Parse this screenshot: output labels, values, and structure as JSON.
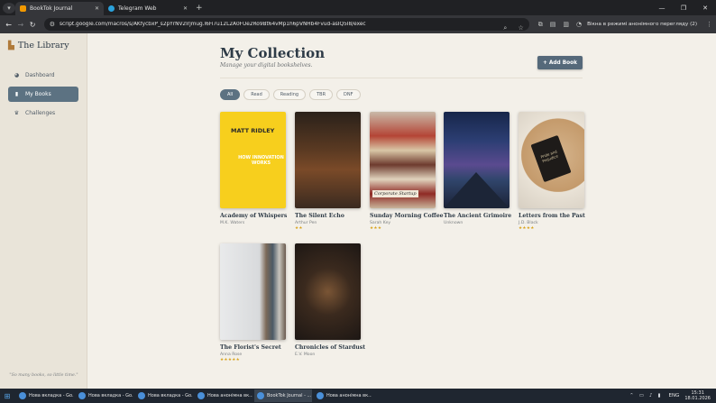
{
  "browser": {
    "tabs": [
      {
        "title": "BookTok Journal",
        "favicon_color": "#f29900",
        "active": true
      },
      {
        "title": "Telegram Web",
        "favicon_color": "#2aa1db",
        "active": false
      }
    ],
    "url": "script.google.com/macros/s/AKfycbxP_s2pYrNV2lrjmug.l6Fi7u12L2A0FUe2Ro9Bt64vMp1h6pVNHb4Fvud-asIQ5I8/exec",
    "incognito_label": "Вікна в режимі анонімного перегляду (2)"
  },
  "sidebar": {
    "brand": "The Library",
    "items": [
      {
        "label": "Dashboard",
        "icon": "dashboard-icon",
        "active": false
      },
      {
        "label": "My Books",
        "icon": "book-icon",
        "active": true
      },
      {
        "label": "Challenges",
        "icon": "trophy-icon",
        "active": false
      }
    ],
    "quote": "\"So many books, so little time.\""
  },
  "main": {
    "title": "My Collection",
    "subtitle": "Manage your digital bookshelves.",
    "add_button": "+ Add Book",
    "filters": [
      "All",
      "Read",
      "Reading",
      "TBR",
      "DNF"
    ],
    "active_filter": "All",
    "books": [
      {
        "title": "Academy of Whispers",
        "author": "M.K. Waters",
        "stars": "",
        "cover_text_1": "MATT RIDLEY",
        "cover_text_2": "HOW INNOVATION WORKS"
      },
      {
        "title": "The Silent Echo",
        "author": "Arthur Pen",
        "stars": "★★"
      },
      {
        "title": "Sunday Morning Coffee",
        "author": "Sarah Key",
        "stars": "★★★",
        "cover_text": "Corporate Startup"
      },
      {
        "title": "The Ancient Grimoire",
        "author": "Unknown",
        "stars": ""
      },
      {
        "title": "Letters from the Past",
        "author": "J.D. Black",
        "stars": "★★★★",
        "cover_text": "Pride and Prejudice"
      },
      {
        "title": "The Florist's Secret",
        "author": "Anna Rose",
        "stars": "★★★★★"
      },
      {
        "title": "Chronicles of Stardust",
        "author": "E.V. Moon",
        "stars": ""
      }
    ]
  },
  "taskbar": {
    "tasks": [
      "Нова вкладка - Go...",
      "Нова вкладка - Go...",
      "Нова вкладка - Go...",
      "Нова анонімна вк...",
      "BookTok Journal - ...",
      "Нова анонімна вк..."
    ],
    "active_task": 4,
    "lang": "ENG",
    "time": "15:31",
    "date": "18.01.2026"
  }
}
